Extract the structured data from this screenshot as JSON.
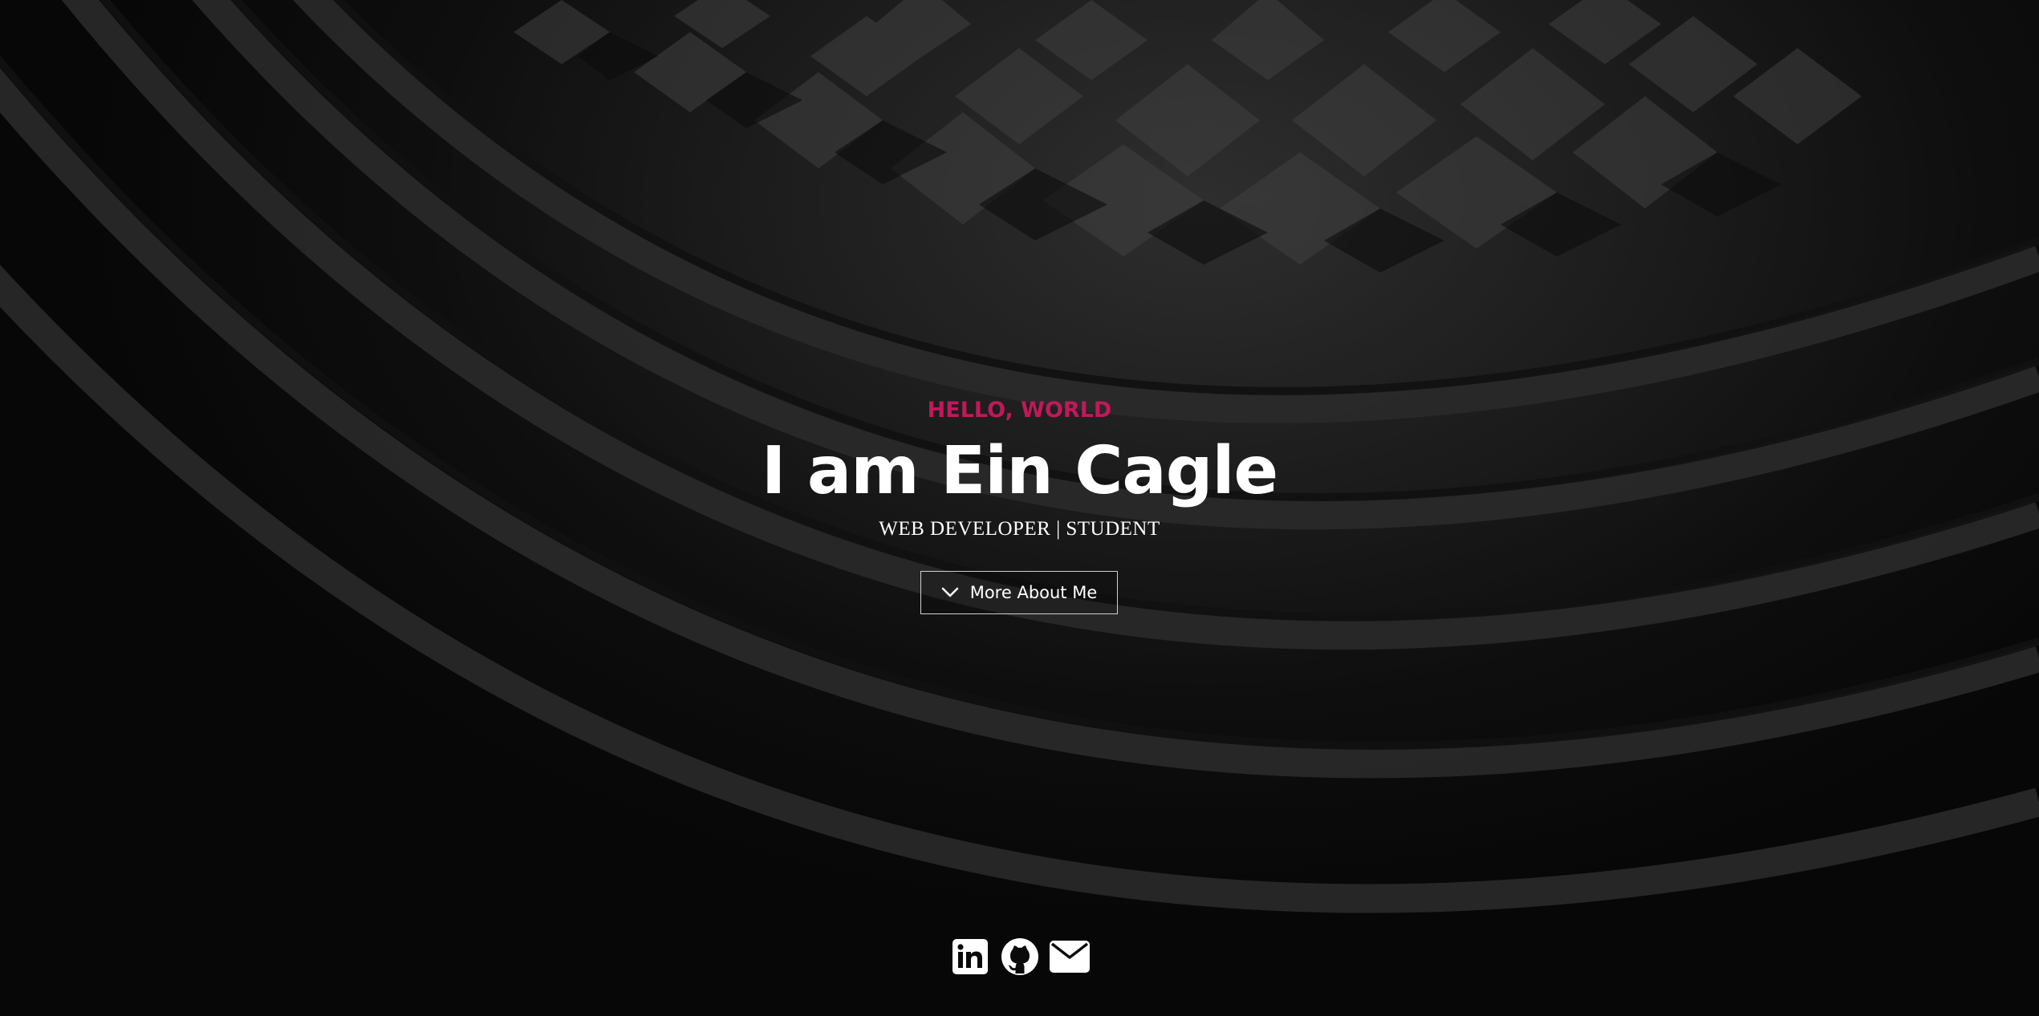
{
  "hero": {
    "greeting": "HELLO, WORLD",
    "title": "I am Ein Cagle",
    "subtitle": "WEB DEVELOPER | STUDENT",
    "cta_label": "More About Me",
    "cta_icon": "chevron-down-icon"
  },
  "social": [
    {
      "name": "linkedin",
      "icon": "linkedin-icon"
    },
    {
      "name": "github",
      "icon": "github-icon"
    },
    {
      "name": "email",
      "icon": "envelope-icon"
    }
  ],
  "colors": {
    "accent": "#c2185b",
    "text": "#ffffff",
    "background": "#0a0a0a"
  }
}
